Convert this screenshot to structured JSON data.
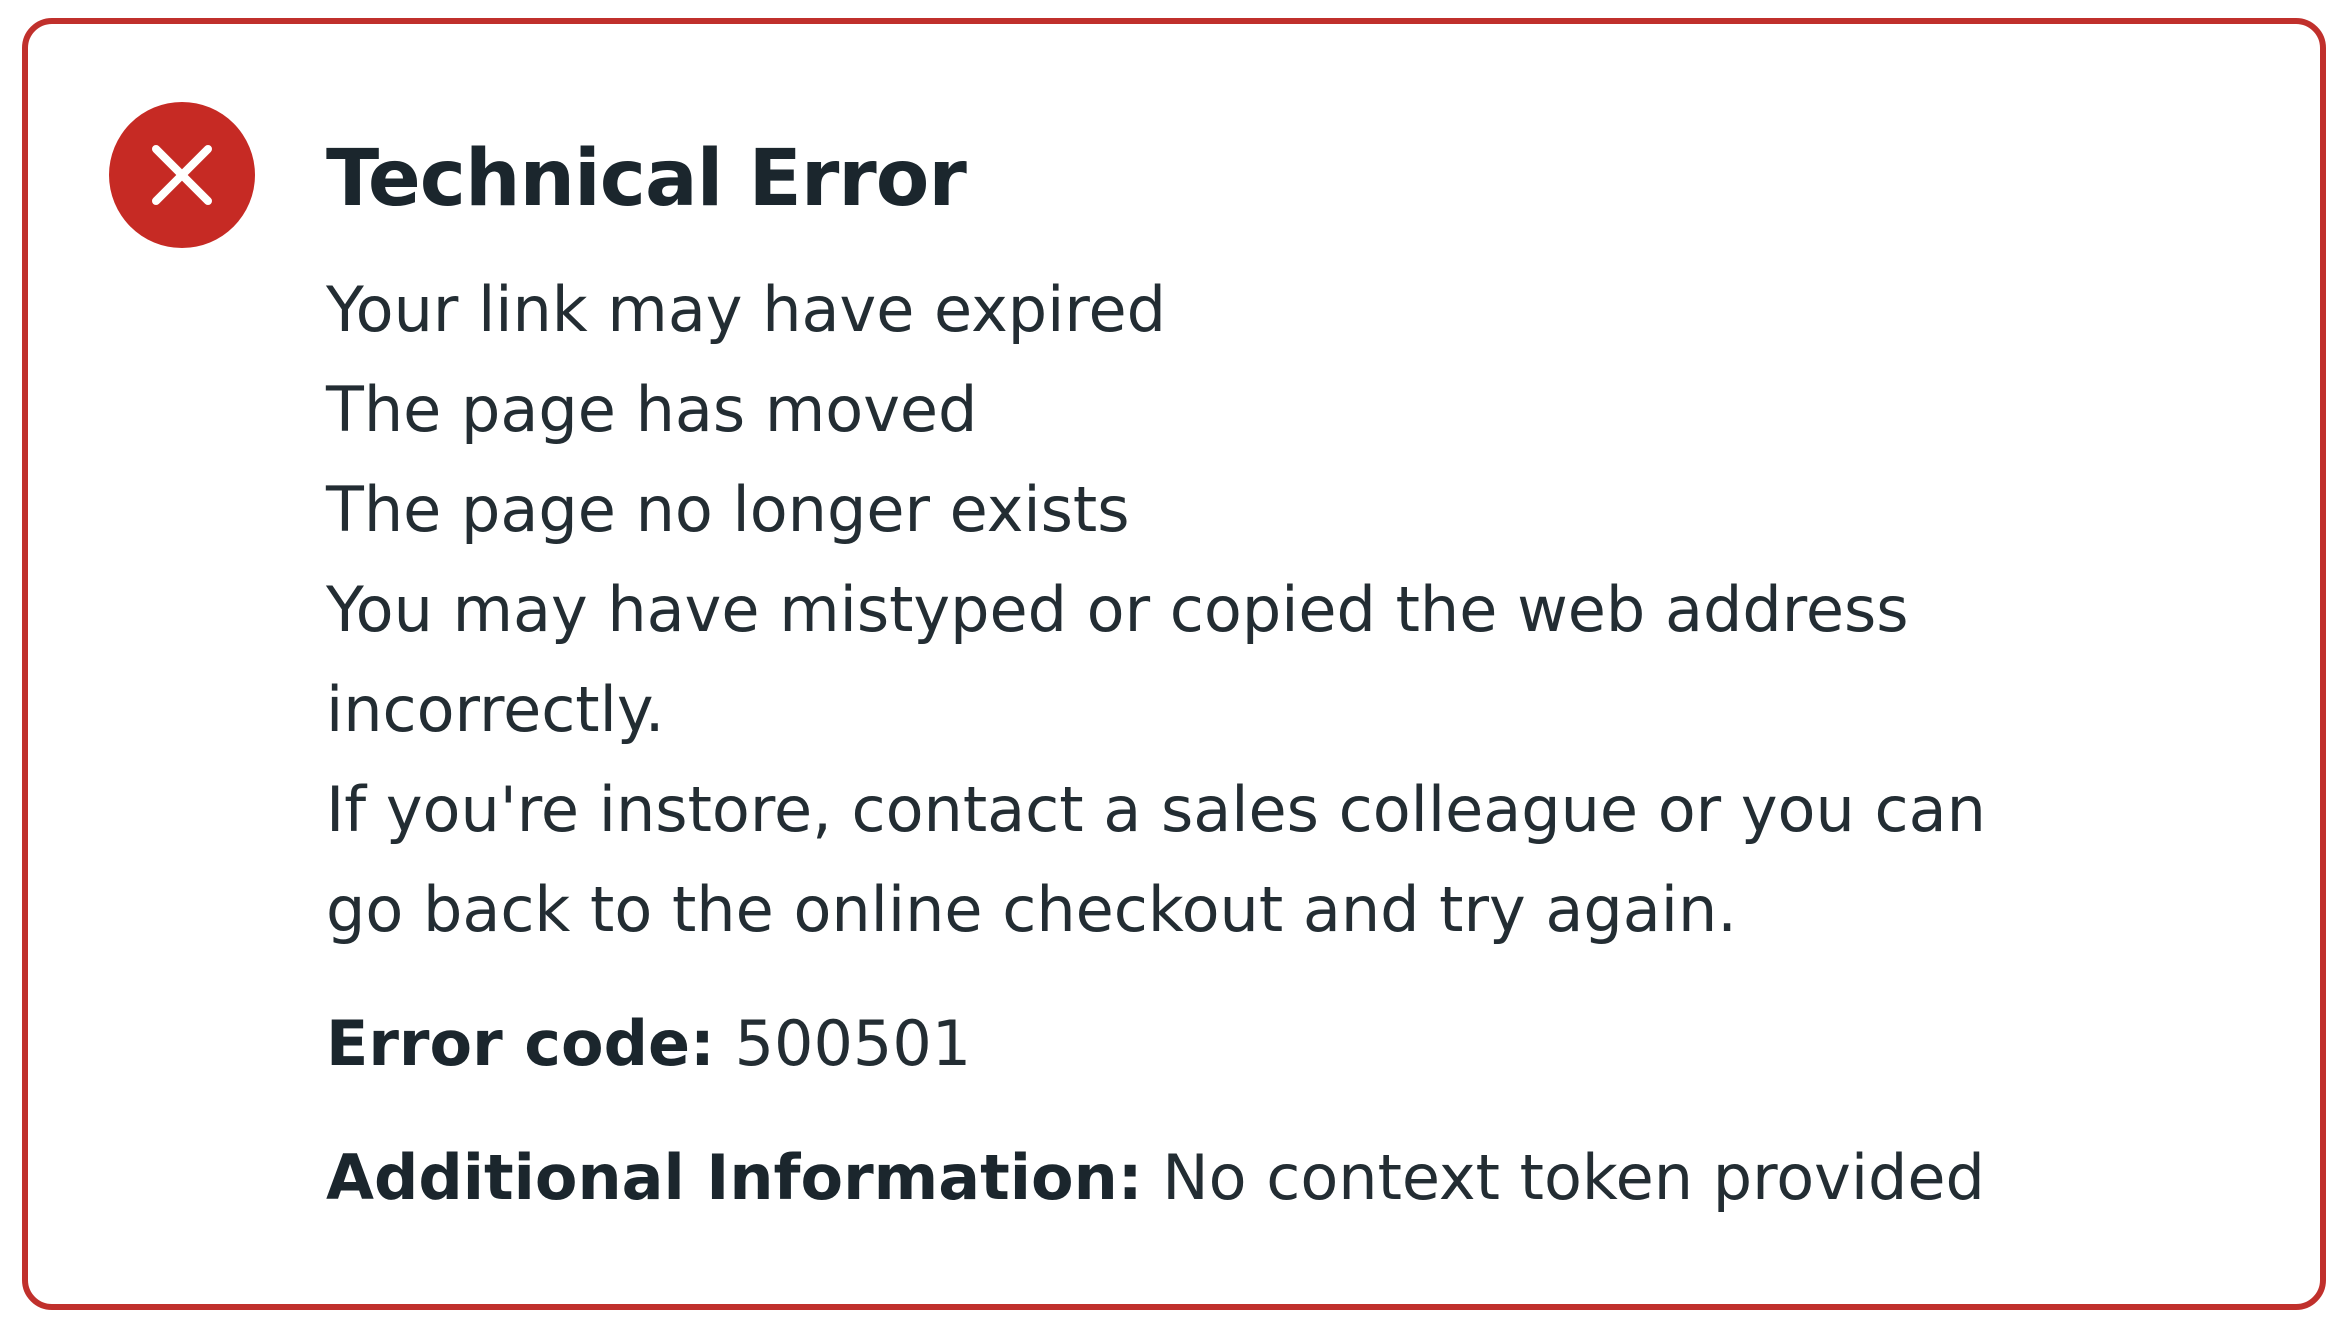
{
  "alert": {
    "icon": "close-circle-icon",
    "accent_color": "#c0302c",
    "title": "Technical Error",
    "reasons": [
      "Your link may have expired",
      "The page has moved",
      "The page no longer exists",
      "You may have mistyped or copied the web address incorrectly.",
      "If you're instore, contact a sales colleague or you can go back to the online checkout and try again."
    ],
    "error_code_label": "Error code:",
    "error_code_value": "500501",
    "additional_info_label": "Additional Information:",
    "additional_info_value": "No context token provided"
  }
}
